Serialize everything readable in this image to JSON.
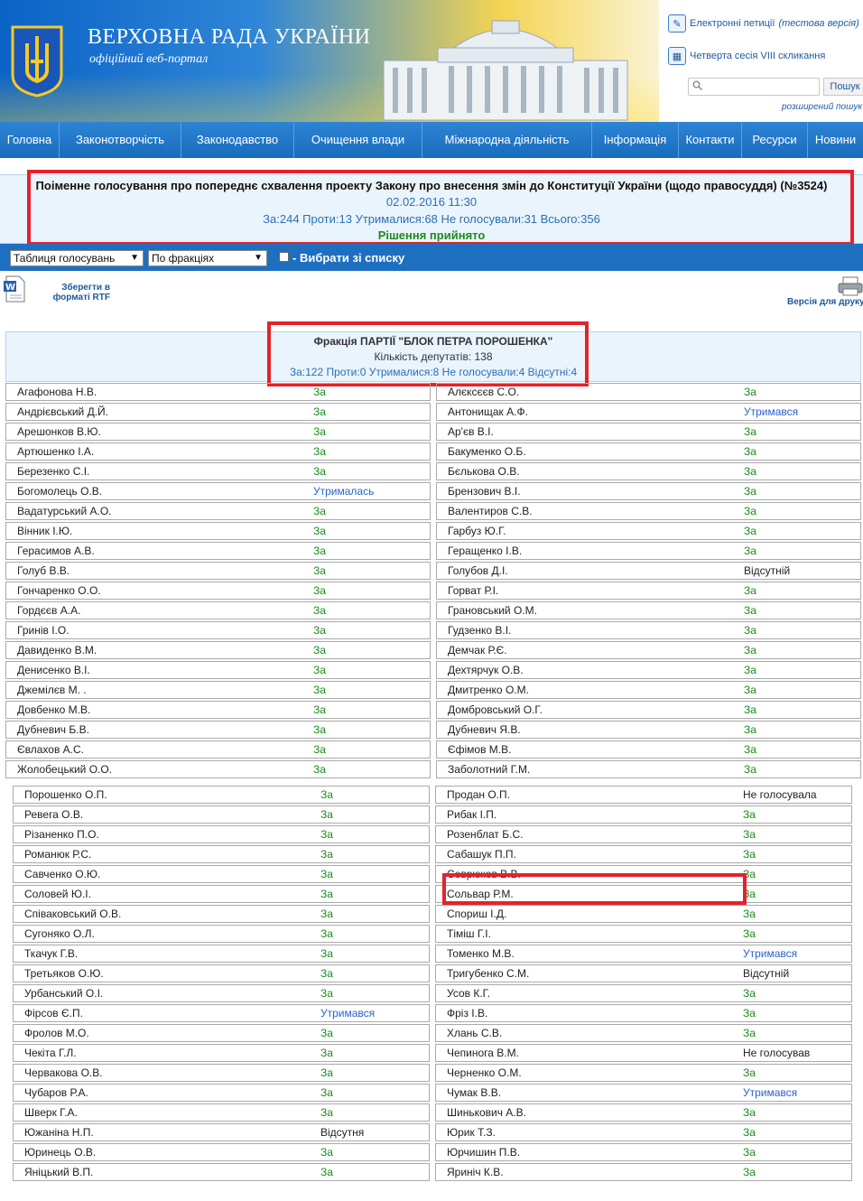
{
  "header": {
    "site_title": "ВЕРХОВНА РАДА УКРАЇНИ",
    "site_subtitle": "офіційний веб-портал",
    "petitions_link": "Електронні петиції",
    "petitions_note": "(тестова версія)",
    "session_link": "Четверта сесія VIII скликання",
    "search_placeholder": "",
    "search_button": "Пошук",
    "advanced_search": "розширений пошук"
  },
  "nav": [
    {
      "label": "Головна"
    },
    {
      "label": "Законотворчість"
    },
    {
      "label": "Законодавство"
    },
    {
      "label": "Очищення влади"
    },
    {
      "label": "Міжнародна діяльність"
    },
    {
      "label": "Інформація"
    },
    {
      "label": "Контакти"
    },
    {
      "label": "Ресурси"
    },
    {
      "label": "Новини"
    }
  ],
  "vote": {
    "title": "Поіменне голосування про попереднє схвалення проекту Закону про внесення змін до Конституції України (щодо правосуддя) (№3524)",
    "datetime": "02.02.2016 11:30",
    "counts": "За:244 Проти:13 Утрималися:68 Не голосували:31 Всього:356",
    "result": "Рішення прийнято"
  },
  "controls": {
    "view_select": "Таблиця голосувань",
    "group_select": "По фракціях",
    "choose_from_list": "- Вибрати зі списку"
  },
  "tools": {
    "save_rtf": "Зберегти в форматі RTF",
    "print_version": "Версія для друку"
  },
  "faction": {
    "name": "Фракція ПАРТІЇ \"БЛОК ПЕТРА ПОРОШЕНКА\"",
    "deputies": "Кількість депутатів: 138",
    "stats": "За:122 Проти:0 Утрималися:8 Не голосували:4 Відсутні:4"
  },
  "colors": {
    "vote_for": "#1d8a1d",
    "abstained": "#2a5fcc",
    "nav_bg": "#1f6fc0",
    "highlight_box": "#e3232a"
  },
  "table_top": [
    {
      "left": {
        "name": "Агафонова Н.В.",
        "vote": "За"
      },
      "right": {
        "name": "Алєксєєв С.О.",
        "vote": "За"
      }
    },
    {
      "left": {
        "name": "Андрієвський Д.Й.",
        "vote": "За"
      },
      "right": {
        "name": "Антонищак А.Ф.",
        "vote": "Утримався"
      }
    },
    {
      "left": {
        "name": "Арешонков В.Ю.",
        "vote": "За"
      },
      "right": {
        "name": "Ар'єв В.І.",
        "vote": "За"
      }
    },
    {
      "left": {
        "name": "Артюшенко І.А.",
        "vote": "За"
      },
      "right": {
        "name": "Бакуменко О.Б.",
        "vote": "За"
      }
    },
    {
      "left": {
        "name": "Березенко С.І.",
        "vote": "За"
      },
      "right": {
        "name": "Бєлькова О.В.",
        "vote": "За"
      }
    },
    {
      "left": {
        "name": "Богомолець О.В.",
        "vote": "Утрималась"
      },
      "right": {
        "name": "Брензович В.І.",
        "vote": "За"
      }
    },
    {
      "left": {
        "name": "Вадатурський А.О.",
        "vote": "За"
      },
      "right": {
        "name": "Валентиров С.В.",
        "vote": "За"
      }
    },
    {
      "left": {
        "name": "Вінник І.Ю.",
        "vote": "За"
      },
      "right": {
        "name": "Гарбуз Ю.Г.",
        "vote": "За"
      }
    },
    {
      "left": {
        "name": "Герасимов А.В.",
        "vote": "За"
      },
      "right": {
        "name": "Геращенко І.В.",
        "vote": "За"
      }
    },
    {
      "left": {
        "name": "Голуб В.В.",
        "vote": "За"
      },
      "right": {
        "name": "Голубов Д.І.",
        "vote": "Відсутній"
      }
    },
    {
      "left": {
        "name": "Гончаренко О.О.",
        "vote": "За"
      },
      "right": {
        "name": "Горват Р.І.",
        "vote": "За"
      }
    },
    {
      "left": {
        "name": "Гордєєв А.А.",
        "vote": "За"
      },
      "right": {
        "name": "Грановський О.М.",
        "vote": "За"
      }
    },
    {
      "left": {
        "name": "Гринів І.О.",
        "vote": "За"
      },
      "right": {
        "name": "Гудзенко В.І.",
        "vote": "За"
      }
    },
    {
      "left": {
        "name": "Давиденко В.М.",
        "vote": "За"
      },
      "right": {
        "name": "Демчак Р.Є.",
        "vote": "За"
      }
    },
    {
      "left": {
        "name": "Денисенко В.І.",
        "vote": "За"
      },
      "right": {
        "name": "Дехтярчук О.В.",
        "vote": "За"
      }
    },
    {
      "left": {
        "name": "Джемілєв М. .",
        "vote": "За"
      },
      "right": {
        "name": "Дмитренко О.М.",
        "vote": "За"
      }
    },
    {
      "left": {
        "name": "Довбенко М.В.",
        "vote": "За"
      },
      "right": {
        "name": "Домбровський О.Г.",
        "vote": "За"
      }
    },
    {
      "left": {
        "name": "Дубневич Б.В.",
        "vote": "За"
      },
      "right": {
        "name": "Дубневич Я.В.",
        "vote": "За"
      }
    },
    {
      "left": {
        "name": "Євлахов А.С.",
        "vote": "За"
      },
      "right": {
        "name": "Єфімов М.В.",
        "vote": "За"
      }
    },
    {
      "left": {
        "name": "Жолобецький О.О.",
        "vote": "За"
      },
      "right": {
        "name": "Заболотний Г.М.",
        "vote": "За"
      }
    }
  ],
  "table_bottom": [
    {
      "left": {
        "name": "Порошенко О.П.",
        "vote": "За"
      },
      "right": {
        "name": "Продан О.П.",
        "vote": "Не голосувала"
      }
    },
    {
      "left": {
        "name": "Ревега О.В.",
        "vote": "За"
      },
      "right": {
        "name": "Рибак І.П.",
        "vote": "За"
      }
    },
    {
      "left": {
        "name": "Різаненко П.О.",
        "vote": "За"
      },
      "right": {
        "name": "Розенблат Б.С.",
        "vote": "За"
      }
    },
    {
      "left": {
        "name": "Романюк Р.С.",
        "vote": "За"
      },
      "right": {
        "name": "Сабашук П.П.",
        "vote": "За"
      }
    },
    {
      "left": {
        "name": "Савченко О.Ю.",
        "vote": "За"
      },
      "right": {
        "name": "Севрюков В.В.",
        "vote": "За"
      }
    },
    {
      "left": {
        "name": "Соловей Ю.І.",
        "vote": "За"
      },
      "right": {
        "name": "Сольвар Р.М.",
        "vote": "За"
      }
    },
    {
      "left": {
        "name": "Співаковський О.В.",
        "vote": "За"
      },
      "right": {
        "name": "Спориш І.Д.",
        "vote": "За"
      }
    },
    {
      "left": {
        "name": "Сугоняко О.Л.",
        "vote": "За"
      },
      "right": {
        "name": "Тіміш Г.І.",
        "vote": "За"
      }
    },
    {
      "left": {
        "name": "Ткачук Г.В.",
        "vote": "За"
      },
      "right": {
        "name": "Томенко М.В.",
        "vote": "Утримався"
      }
    },
    {
      "left": {
        "name": "Третьяков О.Ю.",
        "vote": "За"
      },
      "right": {
        "name": "Тригубенко С.М.",
        "vote": "Відсутній"
      }
    },
    {
      "left": {
        "name": "Урбанський О.І.",
        "vote": "За"
      },
      "right": {
        "name": "Усов К.Г.",
        "vote": "За"
      }
    },
    {
      "left": {
        "name": "Фірсов Є.П.",
        "vote": "Утримався"
      },
      "right": {
        "name": "Фріз І.В.",
        "vote": "За"
      }
    },
    {
      "left": {
        "name": "Фролов М.О.",
        "vote": "За"
      },
      "right": {
        "name": "Хлань С.В.",
        "vote": "За"
      }
    },
    {
      "left": {
        "name": "Чекіта Г.Л.",
        "vote": "За"
      },
      "right": {
        "name": "Чепинога В.М.",
        "vote": "Не голосував"
      }
    },
    {
      "left": {
        "name": "Червакова О.В.",
        "vote": "За"
      },
      "right": {
        "name": "Черненко О.М.",
        "vote": "За"
      }
    },
    {
      "left": {
        "name": "Чубаров Р.А.",
        "vote": "За"
      },
      "right": {
        "name": "Чумак В.В.",
        "vote": "Утримався"
      }
    },
    {
      "left": {
        "name": "Шверк Г.А.",
        "vote": "За"
      },
      "right": {
        "name": "Шинькович А.В.",
        "vote": "За"
      }
    },
    {
      "left": {
        "name": "Южаніна Н.П.",
        "vote": "Відсутня"
      },
      "right": {
        "name": "Юрик Т.З.",
        "vote": "За"
      }
    },
    {
      "left": {
        "name": "Юринець О.В.",
        "vote": "За"
      },
      "right": {
        "name": "Юрчишин П.В.",
        "vote": "За"
      }
    },
    {
      "left": {
        "name": "Яніцький В.П.",
        "vote": "За"
      },
      "right": {
        "name": "Яриніч К.В.",
        "vote": "За"
      }
    }
  ]
}
